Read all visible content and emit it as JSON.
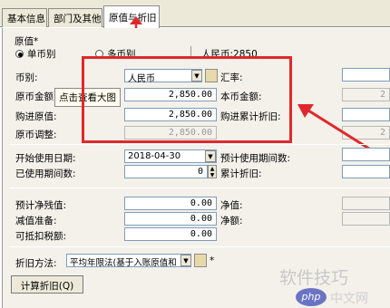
{
  "tabs": [
    "基本信息",
    "部门及其他",
    "原值与折旧"
  ],
  "section_title": "原值*",
  "radio_single": "单币别",
  "radio_multi": "多币别",
  "currency_summary": "人民币:2850",
  "currency_label": "币别:",
  "currency_value": "人民币",
  "exchange_rate_label": "汇率:",
  "orig_amount_label": "原币金额",
  "orig_amount_value": "2,850.00",
  "base_amount_label": "本币金额:",
  "tooltip_text": "点击查看大图",
  "purchase_value_label": "购进原值:",
  "purchase_value": "2,850.00",
  "purchase_dep_label": "购进累计折旧:",
  "orig_adjust_label": "原币调整:",
  "orig_adjust_value": "2,850.00",
  "start_date_label": "开始使用日期:",
  "start_date_value": "2018-04-30",
  "expected_periods_label": "预计使用期间数:",
  "used_periods_label": "已使用期间数:",
  "used_periods_value": "0",
  "accum_dep_label": "累计折旧:",
  "residual_label": "预计净残值:",
  "residual_value": "0.00",
  "net_value_label": "净值:",
  "impairment_label": "减值准备:",
  "impairment_value": "0.00",
  "net_amount_label": "净额:",
  "deductible_label": "可抵扣税额:",
  "deductible_value": "0.00",
  "dep_method_label": "折旧方法:",
  "dep_method_value": "平均年限法(基于入账原值和",
  "calc_dep_button": "计算折旧(Q)",
  "right_partial_a": "2",
  "right_partial_b": "2",
  "watermark_main": "软件技巧",
  "watermark_php": "php",
  "watermark_site": "中文网",
  "colors": {
    "accent_red": "#e0282c",
    "panel_bg": "#f3f1ea",
    "tab_bg": "#ece9d8"
  }
}
